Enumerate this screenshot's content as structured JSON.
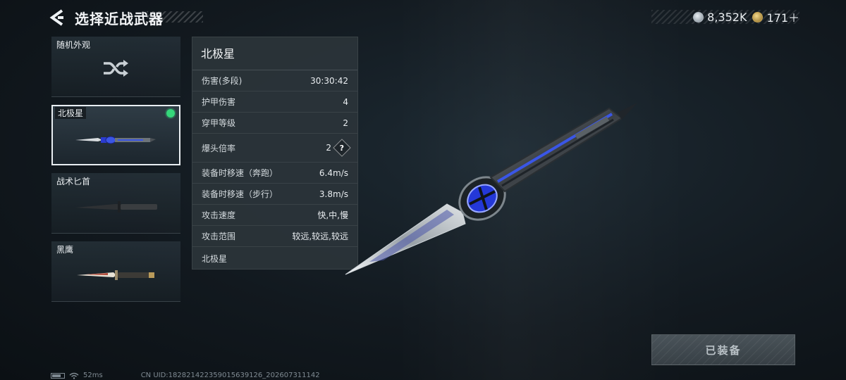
{
  "header": {
    "title": "选择近战武器",
    "back_icon": "back-arrow-icon"
  },
  "currency": {
    "silver": {
      "icon": "silver-coin-icon",
      "value": "8,352K"
    },
    "gold": {
      "icon": "gold-coin-icon",
      "value": "171＋"
    }
  },
  "weapons": [
    {
      "label": "随机外观",
      "icon": "shuffle-icon",
      "selected": false
    },
    {
      "label": "北极星",
      "icon": "polaris-knife-icon",
      "selected": true,
      "equipped": true
    },
    {
      "label": "战术匕首",
      "icon": "tactical-dagger-icon",
      "selected": false
    },
    {
      "label": "黑鹰",
      "icon": "blackhawk-knife-icon",
      "selected": false
    }
  ],
  "stats": {
    "title": "北极星",
    "rows": [
      {
        "label": "伤害(多段)",
        "value": "30:30:42"
      },
      {
        "label": "护甲伤害",
        "value": "4"
      },
      {
        "label": "穿甲等级",
        "value": "2"
      },
      {
        "label": "爆头倍率",
        "value": "2",
        "help": "?"
      },
      {
        "label": "装备时移速（奔跑）",
        "value": "6.4m/s"
      },
      {
        "label": "装备时移速（步行）",
        "value": "3.8m/s"
      },
      {
        "label": "攻击速度",
        "value": "快,中,慢"
      },
      {
        "label": "攻击范围",
        "value": "较远,较远,较远"
      }
    ],
    "skin_name": "北极星"
  },
  "equip_button": {
    "label": "已装备"
  },
  "footer": {
    "ping": "52ms",
    "uid": "CN UID:18282142235901563912​6_202607311142"
  },
  "colors": {
    "equipped_dot": "#35d67a",
    "panel_bg": "#2b343a",
    "knife_accent": "#3a56e6"
  }
}
